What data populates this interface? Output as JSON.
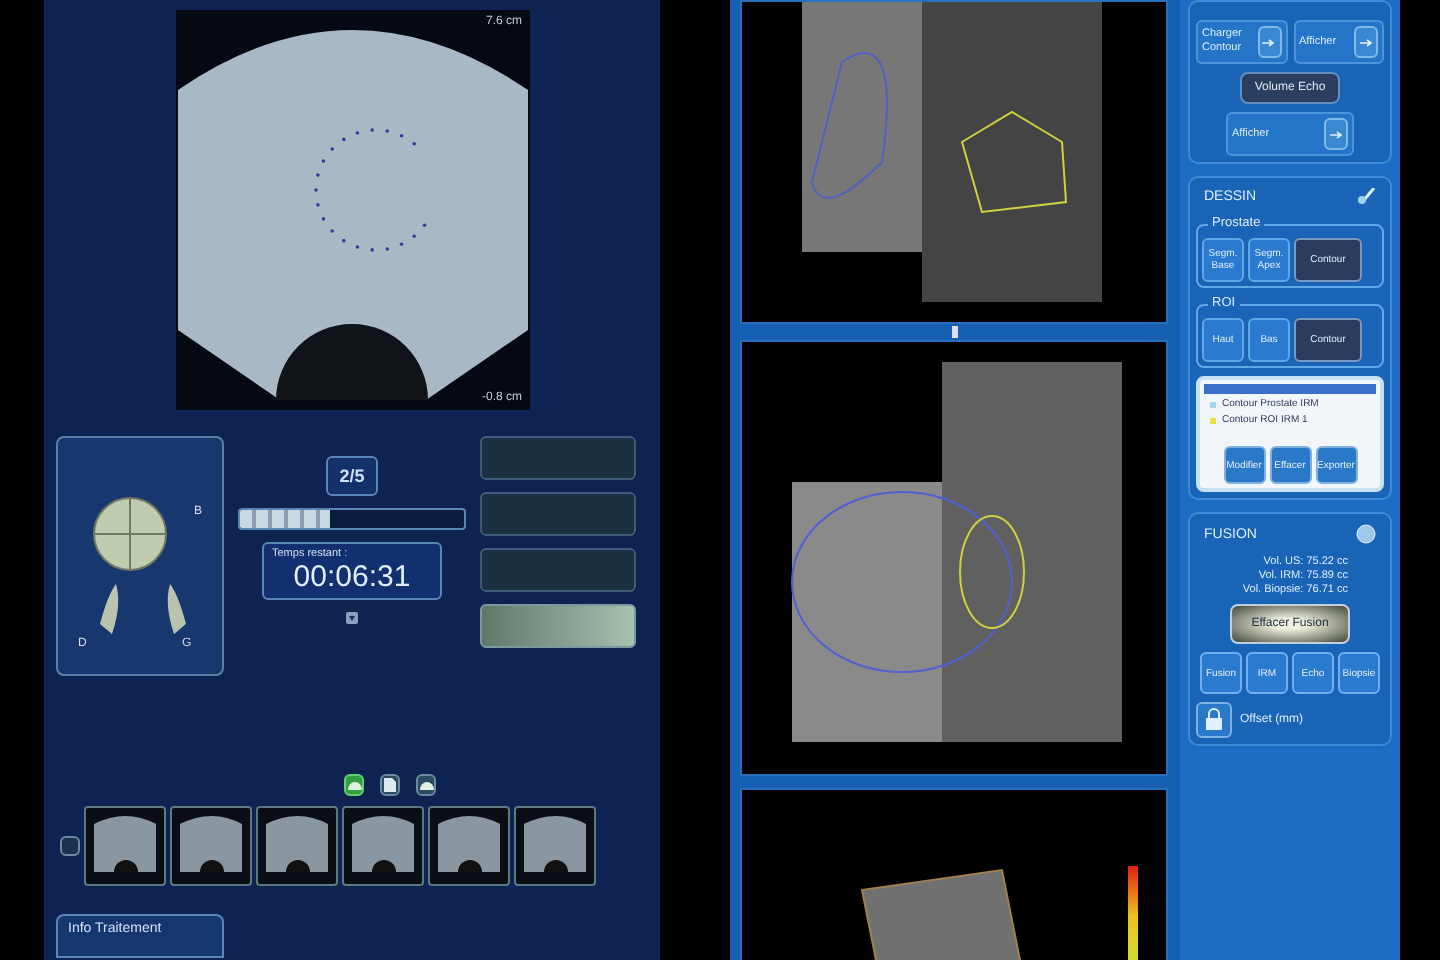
{
  "ultrasound": {
    "depth_top": "7.6 cm",
    "depth_bottom": "-0.8 cm"
  },
  "orientation": {
    "labels": [
      "B",
      "D",
      "G"
    ]
  },
  "session": {
    "counter": "2/5",
    "progress": {
      "level": 0.4
    },
    "timer_label": "Temps restant :",
    "timer": "00:06:31"
  },
  "action_buttons": [
    {
      "enabled": false
    },
    {
      "enabled": false
    },
    {
      "enabled": false
    },
    {
      "enabled": true
    }
  ],
  "view_modes": [
    {
      "kind": "probe",
      "selected": true
    },
    {
      "kind": "document",
      "selected": false
    },
    {
      "kind": "probe",
      "selected": false
    }
  ],
  "info_panel": {
    "title": "Info Traitement"
  },
  "contour_load": {
    "label": "Charger Contour",
    "display": "Afficher"
  },
  "volume": {
    "button": "Volume Echo",
    "display": "Afficher"
  },
  "drawing": {
    "title": "DESSIN",
    "groups": [
      {
        "title": "Prostate",
        "buttons": [
          {
            "label": "Segm. Base",
            "selected": false
          },
          {
            "label": "Segm. Apex",
            "selected": false
          },
          {
            "label": "Contour",
            "selected": true
          }
        ]
      },
      {
        "title": "ROI",
        "buttons": [
          {
            "label": "Haut",
            "selected": false
          },
          {
            "label": "Bas",
            "selected": false
          },
          {
            "label": "Contour",
            "selected": true
          }
        ]
      }
    ],
    "contours": [
      {
        "label": "Contour Prostate IRM",
        "color": "#a0d8f0"
      },
      {
        "label": "Contour ROI IRM 1",
        "color": "#e8e040"
      }
    ],
    "actions": [
      "Modifier",
      "Effacer",
      "Exporter"
    ]
  },
  "fusion": {
    "title": "FUSION",
    "volumes": [
      "Vol. US: 75.22 cc",
      "Vol. IRM: 75.89 cc",
      "Vol. Biopsie: 76.71 cc"
    ],
    "clear_button": "Effacer Fusion",
    "modes": [
      {
        "label": "Fusion",
        "selected": false
      },
      {
        "label": "IRM",
        "selected": false
      },
      {
        "label": "Echo",
        "selected": false
      },
      {
        "label": "Biopsie",
        "selected": false
      }
    ],
    "offset_label": "Offset (mm)"
  }
}
